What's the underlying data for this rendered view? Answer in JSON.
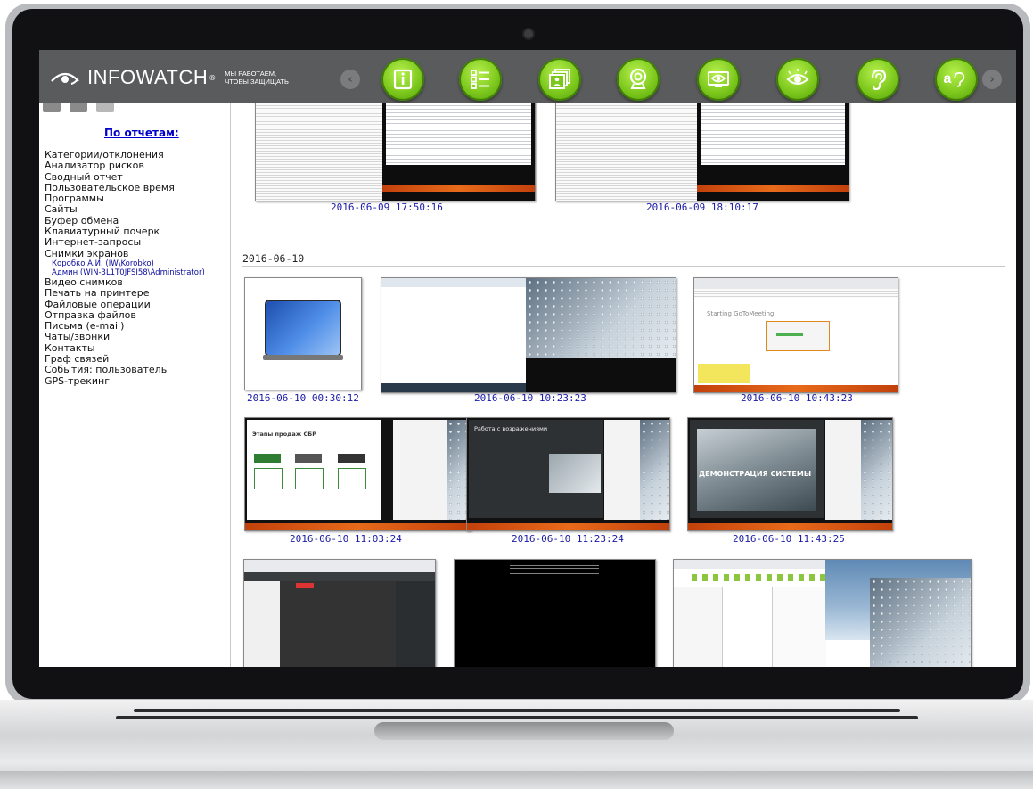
{
  "brand": {
    "name": "INFOWATCH",
    "registered": "®",
    "tagline_line1": "МЫ РАБОТАЕМ,",
    "tagline_line2": "ЧТОБЫ ЗАЩИЩАТЬ"
  },
  "toolbar": {
    "prev_icon": "chevron-left-icon",
    "next_icon": "chevron-right-icon",
    "modules": [
      {
        "icon": "info-icon"
      },
      {
        "icon": "checklist-icon"
      },
      {
        "icon": "screenshots-icon"
      },
      {
        "icon": "webcam-icon"
      },
      {
        "icon": "monitor-eye-icon"
      },
      {
        "icon": "eye-icon"
      },
      {
        "icon": "ear-icon"
      },
      {
        "icon": "ear-text-icon",
        "label": "a"
      }
    ],
    "accent_color": "#7cc71c"
  },
  "sidebar": {
    "heading": "По отчетам:",
    "items": [
      {
        "label": "Категории/отклонения"
      },
      {
        "label": "Анализатор рисков"
      },
      {
        "label": "Сводный отчет"
      },
      {
        "label": "Пользовательское время"
      },
      {
        "label": "Программы"
      },
      {
        "label": "Сайты"
      },
      {
        "label": "Буфер обмена"
      },
      {
        "label": "Клавиатурный почерк"
      },
      {
        "label": "Интернет-запросы"
      },
      {
        "label": "Снимки экранов"
      }
    ],
    "users": [
      {
        "label": "Коробко А.И. (IW\\Korobko)"
      },
      {
        "label": "Админ (WIN-3L1T0JFSI58\\Administrator)"
      }
    ],
    "items2": [
      {
        "label": "Видео снимков"
      },
      {
        "label": "Печать на принтере"
      },
      {
        "label": "Файловые операции"
      },
      {
        "label": "Отправка файлов"
      },
      {
        "label": "Письма (e-mail)"
      },
      {
        "label": "Чаты/звонки"
      },
      {
        "label": "Контакты"
      },
      {
        "label": "Граф связей"
      },
      {
        "label": "События: пользователь"
      },
      {
        "label": "GPS-трекинг"
      }
    ]
  },
  "content": {
    "prev_group": {
      "timestamps": [
        "2016-06-09 17:50:16",
        "2016-06-09 18:10:17"
      ]
    },
    "group": {
      "date": "2016-06-10",
      "row1": [
        "2016-06-10 00:30:12",
        "2016-06-10 10:23:23",
        "2016-06-10 10:43:23"
      ],
      "row2": [
        "2016-06-10 11:03:24",
        "2016-06-10 11:23:24",
        "2016-06-10 11:43:25"
      ],
      "thumb_text": {
        "stages_title": "Этапы продаж СБР",
        "demo_banner": "ДЕМОНСТРАЦИЯ СИСТЕМЫ",
        "remote_title": "Работа с возражениями",
        "gotomeeting": "Starting GoToMeeting"
      }
    }
  }
}
